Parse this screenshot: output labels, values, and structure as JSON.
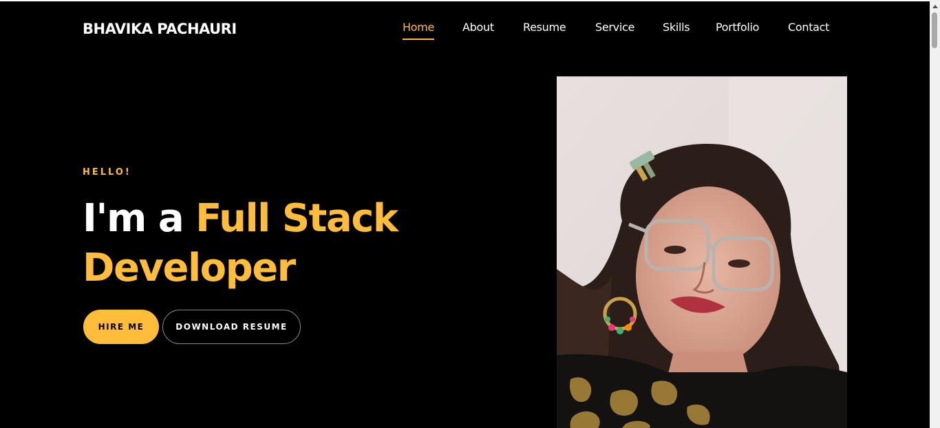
{
  "brand": "BHAVIKA PACHAURI",
  "nav": {
    "items": [
      "Home",
      "About",
      "Resume",
      "Service",
      "Skills",
      "Portfolio",
      "Contact"
    ],
    "active": "Home"
  },
  "hero": {
    "greeting": "HELLO!",
    "headline_prefix": "I'm a ",
    "headline_accent_1": "Full Stack",
    "headline_accent_2": "Developer",
    "hire_label": "HIRE ME",
    "download_label": "DOWNLOAD RESUME"
  },
  "colors": {
    "accent": "#ffbd39",
    "background": "#000000",
    "text": "#ffffff"
  },
  "icons": {
    "scroll_up": "triangle-up-icon"
  }
}
